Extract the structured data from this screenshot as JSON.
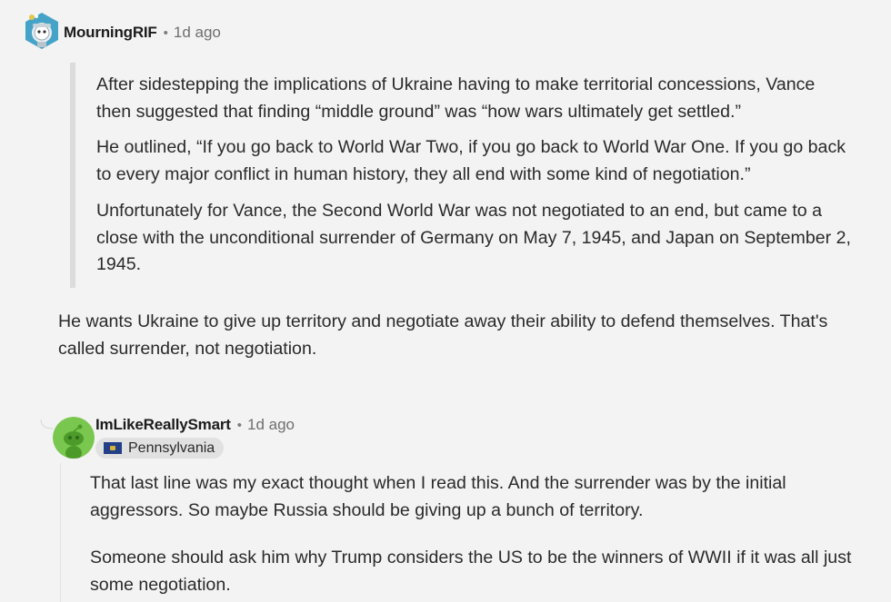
{
  "comment1": {
    "username": "MourningRIF",
    "separator": "•",
    "time": "1d ago",
    "quote_paragraphs": [
      "After sidestepping the implications of Ukraine having to make territorial concessions, Vance then suggested that finding “middle ground” was “how wars ultimately get settled.”",
      "He outlined, “If you go back to World War Two, if you go back to World War One. If you go back to every major conflict in human history, they all end with some kind of negotiation.”",
      "Unfortunately for Vance, the Second World War was not negotiated to an end, but came to a close with the unconditional surrender of Germany on May 7, 1945, and Japan on September 2, 1945."
    ],
    "body": "He wants Ukraine to give up territory and negotiate away their ability to defend themselves. That's called surrender, not negotiation."
  },
  "comment2": {
    "username": "ImLikeReallySmart",
    "separator": "•",
    "time": "1d ago",
    "flair": "Pennsylvania",
    "paragraphs": [
      "That last line was my exact thought when I read this. And the surrender was by the initial aggressors. So maybe Russia should be giving up a bunch of territory.",
      "Someone should ask him why Trump considers the US to be the winners of WWII if it was all just some negotiation."
    ]
  },
  "icons": {
    "avatar1": "snoo-astronaut-avatar-icon",
    "avatar2": "snoo-green-avatar-icon",
    "flair_flag": "pennsylvania-flag-icon"
  }
}
